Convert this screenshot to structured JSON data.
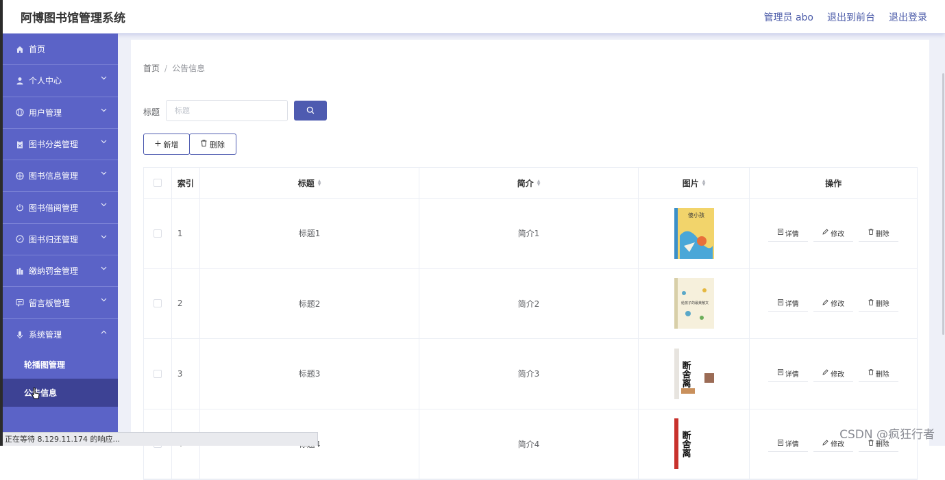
{
  "header": {
    "title": "阿博图书馆管理系统",
    "admin": "管理员 abo",
    "to_frontend": "退出到前台",
    "logout": "退出登录"
  },
  "sidebar": {
    "items": [
      {
        "label": "首页",
        "icon": "home-icon"
      },
      {
        "label": "个人中心",
        "icon": "user-icon"
      },
      {
        "label": "用户管理",
        "icon": "globe-icon"
      },
      {
        "label": "图书分类管理",
        "icon": "clipboard-icon"
      },
      {
        "label": "图书信息管理",
        "icon": "globe-icon"
      },
      {
        "label": "图书借阅管理",
        "icon": "power-icon"
      },
      {
        "label": "图书归还管理",
        "icon": "compass-icon"
      },
      {
        "label": "缴纳罚金管理",
        "icon": "chart-icon"
      },
      {
        "label": "留言板管理",
        "icon": "message-icon"
      },
      {
        "label": "系统管理",
        "icon": "microphone-icon"
      }
    ],
    "sub_items": [
      {
        "label": "轮播图管理"
      },
      {
        "label": "公告信息"
      }
    ]
  },
  "breadcrumb": {
    "home": "首页",
    "current": "公告信息"
  },
  "search": {
    "label": "标题",
    "placeholder": "标题"
  },
  "actions": {
    "add": "新增",
    "delete": "删除"
  },
  "table": {
    "headers": {
      "index": "索引",
      "title": "标题",
      "desc": "简介",
      "image": "图片",
      "ops": "操作"
    },
    "rows": [
      {
        "index": "1",
        "title": "标题1",
        "desc": "简介1",
        "cover_text": "傻小孩"
      },
      {
        "index": "2",
        "title": "标题2",
        "desc": "简介2",
        "cover_text": "给孩子的最美散文"
      },
      {
        "index": "3",
        "title": "标题3",
        "desc": "简介3",
        "cover_text": "断舍离"
      },
      {
        "index": "4",
        "title": "标题4",
        "desc": "简介4",
        "cover_text": "断舍离"
      }
    ],
    "ops": {
      "detail": "详情",
      "edit": "修改",
      "delete": "删除"
    }
  },
  "status_bar": "正在等待 8.129.11.174 的响应...",
  "watermark": "CSDN @疯狂行者",
  "colors": {
    "sidebar": "#5b63c7",
    "sidebar_active": "#3d4294",
    "primary": "#4e5bb0"
  }
}
